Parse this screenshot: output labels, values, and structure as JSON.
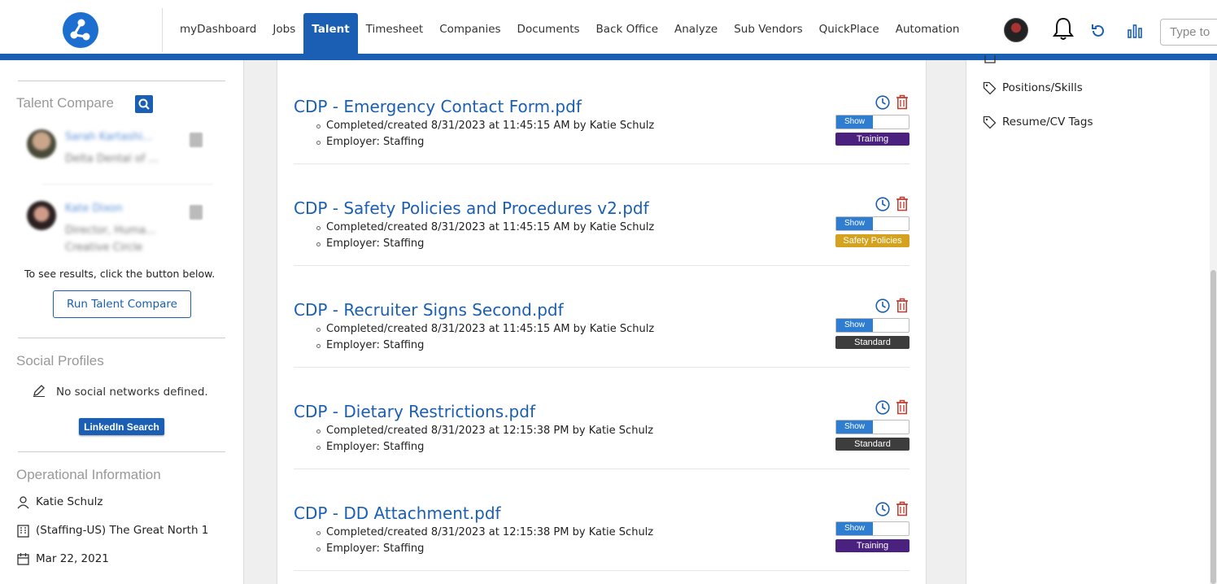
{
  "nav": {
    "items": [
      "myDashboard",
      "Jobs",
      "Talent",
      "Timesheet",
      "Companies",
      "Documents",
      "Back Office",
      "Analyze",
      "Sub Vendors",
      "QuickPlace",
      "Automation"
    ],
    "active": "Talent",
    "search_placeholder": "Type to"
  },
  "left": {
    "talent_compare_title": "Talent Compare",
    "people": [
      {
        "name": "Sarah Kartashi...",
        "sub1": "Delta Dental of ...",
        "sub2": ""
      },
      {
        "name": "Kate Dixon",
        "sub1": "Director, Huma...",
        "sub2": "Creative Circle"
      }
    ],
    "compare_hint": "To see results, click the button below.",
    "run_compare_label": "Run Talent Compare",
    "social_title": "Social Profiles",
    "no_social": "No social networks defined.",
    "linkedin_label": "LinkedIn Search",
    "operational_title": "Operational Information",
    "operational": [
      {
        "icon": "user-icon",
        "text": "Katie Schulz"
      },
      {
        "icon": "building-icon",
        "text": "(Staffing-US) The Great North 1"
      },
      {
        "icon": "calendar-icon",
        "text": "Mar 22, 2021"
      }
    ]
  },
  "documents": [
    {
      "title": "CDP - Emergency Contact Form.pdf",
      "completed": "Completed/created 8/31/2023 at 11:45:15 AM by Katie Schulz",
      "employer": "Employer: Staffing",
      "toggle": "Show",
      "tag": "Training",
      "tag_color": "#4b2180"
    },
    {
      "title": "CDP - Safety Policies and Procedures v2.pdf",
      "completed": "Completed/created 8/31/2023 at 11:45:15 AM by Katie Schulz",
      "employer": "Employer: Staffing",
      "toggle": "Show",
      "tag": "Safety Policies",
      "tag_color": "#d4a21e"
    },
    {
      "title": "CDP - Recruiter Signs Second.pdf",
      "completed": "Completed/created 8/31/2023 at 11:45:15 AM by Katie Schulz",
      "employer": "Employer: Staffing",
      "toggle": "Show",
      "tag": "Standard",
      "tag_color": "#3d3d3d"
    },
    {
      "title": "CDP - Dietary Restrictions.pdf",
      "completed": "Completed/created 8/31/2023 at 12:15:38 PM by Katie Schulz",
      "employer": "Employer: Staffing",
      "toggle": "Show",
      "tag": "Standard",
      "tag_color": "#3d3d3d"
    },
    {
      "title": "CDP - DD Attachment.pdf",
      "completed": "Completed/created 8/31/2023 at 12:15:38 PM by Katie Schulz",
      "employer": "Employer: Staffing",
      "toggle": "Show",
      "tag": "Training",
      "tag_color": "#4b2180"
    }
  ],
  "right": {
    "items": [
      "Positions/Skills",
      "Resume/CV Tags"
    ]
  },
  "colors": {
    "primary": "#1a5fb4",
    "toggle_on": "#2f7dd1",
    "trash": "#c0392b"
  }
}
